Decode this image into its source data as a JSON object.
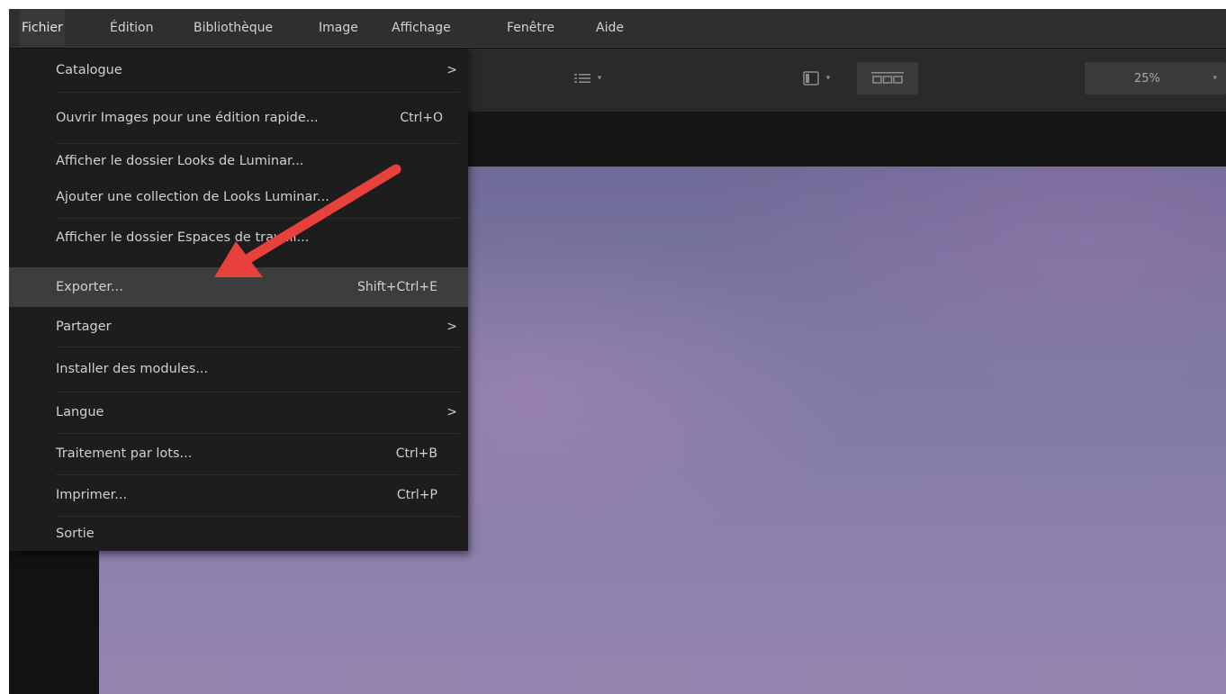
{
  "menubar": {
    "items": [
      {
        "label": "Fichier"
      },
      {
        "label": "Édition"
      },
      {
        "label": "Bibliothèque"
      },
      {
        "label": "Image"
      },
      {
        "label": "Affichage"
      },
      {
        "label": "Fenêtre"
      },
      {
        "label": "Aide"
      }
    ]
  },
  "toolbar": {
    "zoom_value": "25%",
    "icons": [
      "list-icon",
      "panel-layout-icon",
      "filmstrip-icon",
      "chevron-down-icon"
    ]
  },
  "file_menu": {
    "items": [
      {
        "label": "Catalogue",
        "shortcut": "",
        "submenu": ">"
      },
      {
        "label": "Ouvrir Images pour une édition rapide...",
        "shortcut": "Ctrl+O",
        "submenu": ""
      },
      {
        "label": "Afficher le dossier Looks de Luminar...",
        "shortcut": "",
        "submenu": ""
      },
      {
        "label": "Ajouter une collection de Looks Luminar...",
        "shortcut": "",
        "submenu": ""
      },
      {
        "label": "Afficher le dossier Espaces de travail...",
        "shortcut": "",
        "submenu": ""
      },
      {
        "label": "Exporter...",
        "shortcut": "Shift+Ctrl+E",
        "submenu": ""
      },
      {
        "label": "Partager",
        "shortcut": "",
        "submenu": ">"
      },
      {
        "label": "Installer des modules...",
        "shortcut": "",
        "submenu": ""
      },
      {
        "label": "Langue",
        "shortcut": "",
        "submenu": ">"
      },
      {
        "label": "Traitement par lots...",
        "shortcut": "Ctrl+B",
        "submenu": ""
      },
      {
        "label": "Imprimer...",
        "shortcut": "Ctrl+P",
        "submenu": ""
      },
      {
        "label": "Sortie",
        "shortcut": "",
        "submenu": ""
      }
    ]
  },
  "colors": {
    "annotation_arrow": "#e8413c",
    "menu_background": "#1d1d1d",
    "menu_highlight": "#3d3d3d"
  }
}
